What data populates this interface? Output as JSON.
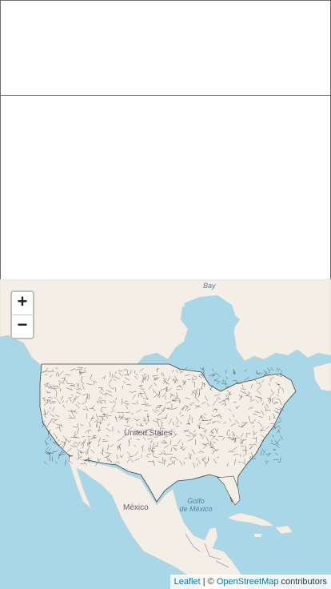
{
  "map": {
    "labels": {
      "bay": "Bay",
      "united_states": "United States",
      "mexico": "México",
      "gulf_line1": "Golfo",
      "gulf_line2": "de México"
    },
    "zoom": {
      "in_label": "+",
      "out_label": "−"
    },
    "attribution": {
      "leaflet": "Leaflet",
      "separator": " | © ",
      "osm": "OpenStreetMap",
      "suffix": " contributors"
    },
    "colors": {
      "water": "#a8d8e8",
      "land": "#f3efe6",
      "boundary_lines": "#222222"
    }
  }
}
